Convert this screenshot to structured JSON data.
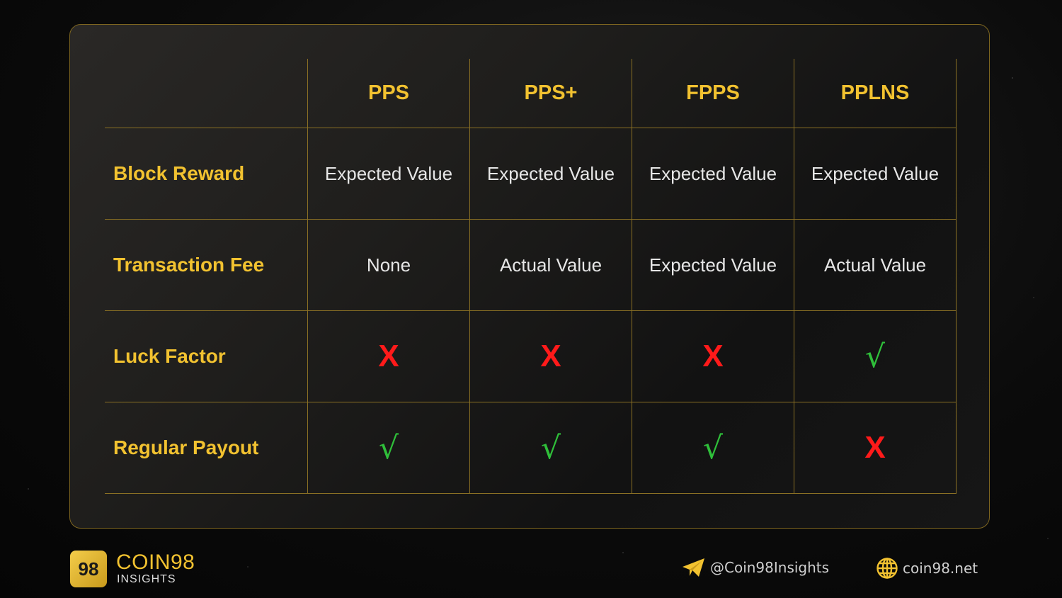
{
  "table": {
    "columns": [
      "PPS",
      "PPS+",
      "FPPS",
      "PPLNS"
    ],
    "rows": [
      {
        "label": "Block Reward",
        "cells": [
          {
            "type": "text",
            "value": "Expected Value"
          },
          {
            "type": "text",
            "value": "Expected Value"
          },
          {
            "type": "text",
            "value": "Expected Value"
          },
          {
            "type": "text",
            "value": "Expected Value"
          }
        ]
      },
      {
        "label": "Transaction Fee",
        "cells": [
          {
            "type": "text",
            "value": "None"
          },
          {
            "type": "text",
            "value": "Actual Value"
          },
          {
            "type": "text",
            "value": "Expected Value"
          },
          {
            "type": "text",
            "value": "Actual Value"
          }
        ]
      },
      {
        "label": "Luck Factor",
        "cells": [
          {
            "type": "no",
            "value": "X"
          },
          {
            "type": "no",
            "value": "X"
          },
          {
            "type": "no",
            "value": "X"
          },
          {
            "type": "yes",
            "value": "√"
          }
        ]
      },
      {
        "label": "Regular Payout",
        "cells": [
          {
            "type": "yes",
            "value": "√"
          },
          {
            "type": "yes",
            "value": "√"
          },
          {
            "type": "yes",
            "value": "√"
          },
          {
            "type": "no",
            "value": "X"
          }
        ]
      }
    ]
  },
  "footer": {
    "logo_mark": "98",
    "brand": "COIN98",
    "brand_sub": "INSIGHTS",
    "telegram_icon": "telegram-icon",
    "telegram_handle": "@Coin98Insights",
    "globe_icon": "globe-icon",
    "website": "coin98.net"
  },
  "colors": {
    "accent": "#f2c230",
    "border": "#8a7024",
    "no": "#ff1a1a",
    "yes": "#2fbf3a"
  }
}
